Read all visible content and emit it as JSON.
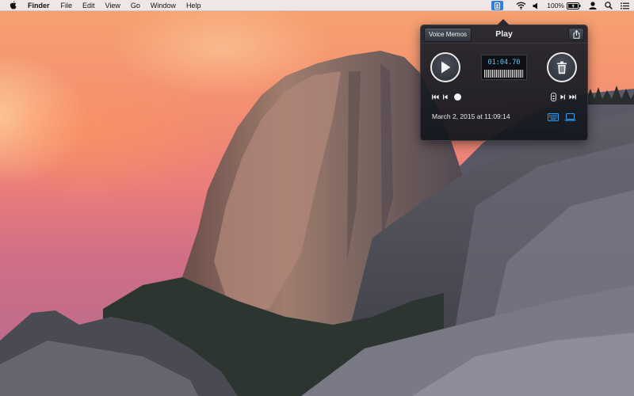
{
  "menubar": {
    "apple_icon": "apple-logo-icon",
    "app_name": "Finder",
    "menus": [
      "File",
      "Edit",
      "View",
      "Go",
      "Window",
      "Help"
    ],
    "status": {
      "icons": [
        "voice-memos-extension-icon",
        "wifi-icon",
        "volume-icon",
        "battery-icon",
        "user-icon",
        "spotlight-search-icon",
        "notification-center-icon"
      ],
      "battery_percent": "100%"
    }
  },
  "popover": {
    "back_button_label": "Voice Memos",
    "title": "Play",
    "share_icon": "share-icon",
    "play_icon": "play-icon",
    "trash_icon": "trash-icon",
    "elapsed_time": "01:04.70",
    "playback_progress": 0.0,
    "transport_icons": [
      "rewind-start-icon",
      "step-back-icon",
      "step-forward-icon",
      "fast-forward-end-icon"
    ],
    "speed_icon": "speed-stepper-icon",
    "recording_date": "March 2, 2015 at 11:09:14",
    "device_icons": [
      "keyboard-icon",
      "laptop-icon"
    ],
    "accent_color": "#2d9bf0",
    "time_color": "#59c6ff"
  }
}
